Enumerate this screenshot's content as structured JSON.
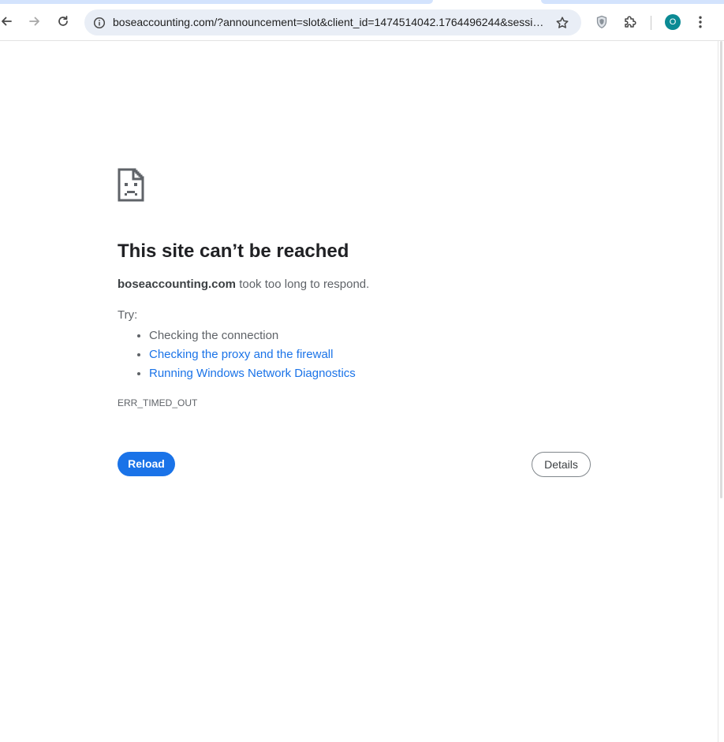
{
  "browser": {
    "url": "boseaccounting.com/?announcement=slot&client_id=1474514042.1764496244&sessio...",
    "profile_initial": "O",
    "icons": {
      "back": "arrow-left-icon",
      "forward": "arrow-right-icon",
      "reload": "reload-icon",
      "site_info": "info-circle-icon",
      "bookmark": "star-outline-icon",
      "extension_shield": "shield-icon",
      "extensions": "puzzle-piece-icon",
      "menu": "vertical-dots-icon"
    },
    "colors": {
      "omnibox_bg": "#e9eef6",
      "tab_highlight": "#d3e3fd",
      "avatar_bg": "#0b8a94"
    }
  },
  "error_page": {
    "icon": "sad-page-icon",
    "headline": "This site can’t be reached",
    "summary_domain": "boseaccounting.com",
    "summary_text": " took too long to respond.",
    "try_label": "Try:",
    "suggestions": [
      "Checking the connection",
      "Checking the proxy and the firewall",
      "Running Windows Network Diagnostics"
    ],
    "error_code": "ERR_TIMED_OUT",
    "reload_label": "Reload",
    "details_label": "Details",
    "colors": {
      "link": "#1a73e8",
      "primary_button": "#1a73e8",
      "text_secondary": "#5f6368"
    }
  }
}
